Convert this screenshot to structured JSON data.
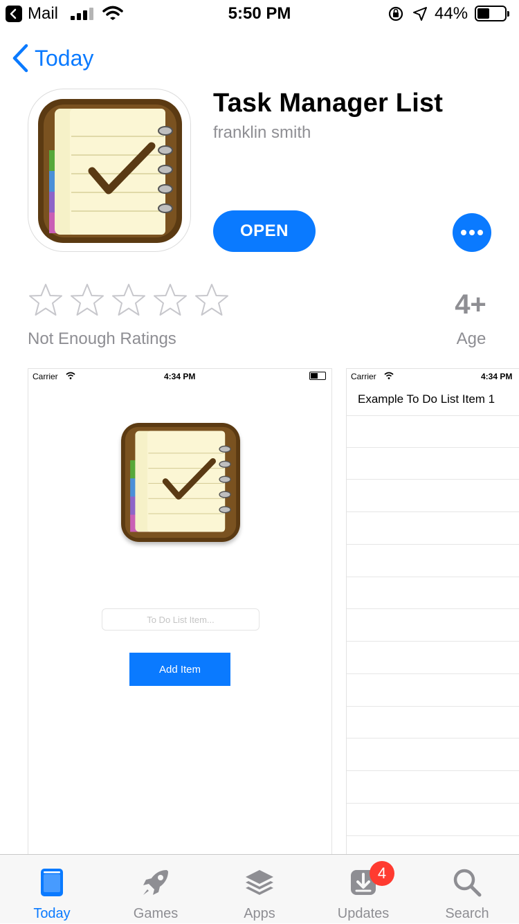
{
  "status_bar": {
    "back_app": "Mail",
    "time": "5:50 PM",
    "battery_pct": "44%",
    "battery_level": 0.44
  },
  "nav": {
    "back_label": "Today"
  },
  "app": {
    "title": "Task Manager List",
    "developer": "franklin smith",
    "open_label": "OPEN"
  },
  "ratings": {
    "label": "Not Enough Ratings",
    "age_value": "4+",
    "age_label": "Age"
  },
  "screenshot1": {
    "carrier": "Carrier",
    "time": "4:34 PM",
    "input_placeholder": "To Do List Item...",
    "button_label": "Add Item"
  },
  "screenshot2": {
    "carrier": "Carrier",
    "time": "4:34 PM",
    "first_item": "Example To Do List Item 1"
  },
  "tabbar": {
    "tabs": [
      {
        "label": "Today",
        "icon": "today-icon",
        "active": true
      },
      {
        "label": "Games",
        "icon": "rocket-icon",
        "active": false
      },
      {
        "label": "Apps",
        "icon": "layers-icon",
        "active": false
      },
      {
        "label": "Updates",
        "icon": "download-icon",
        "active": false
      },
      {
        "label": "Search",
        "icon": "search-icon",
        "active": false
      }
    ],
    "updates_badge": "4"
  },
  "colors": {
    "accent": "#0a7aff",
    "badge": "#ff3b30",
    "secondary_text": "#8e8e93"
  }
}
